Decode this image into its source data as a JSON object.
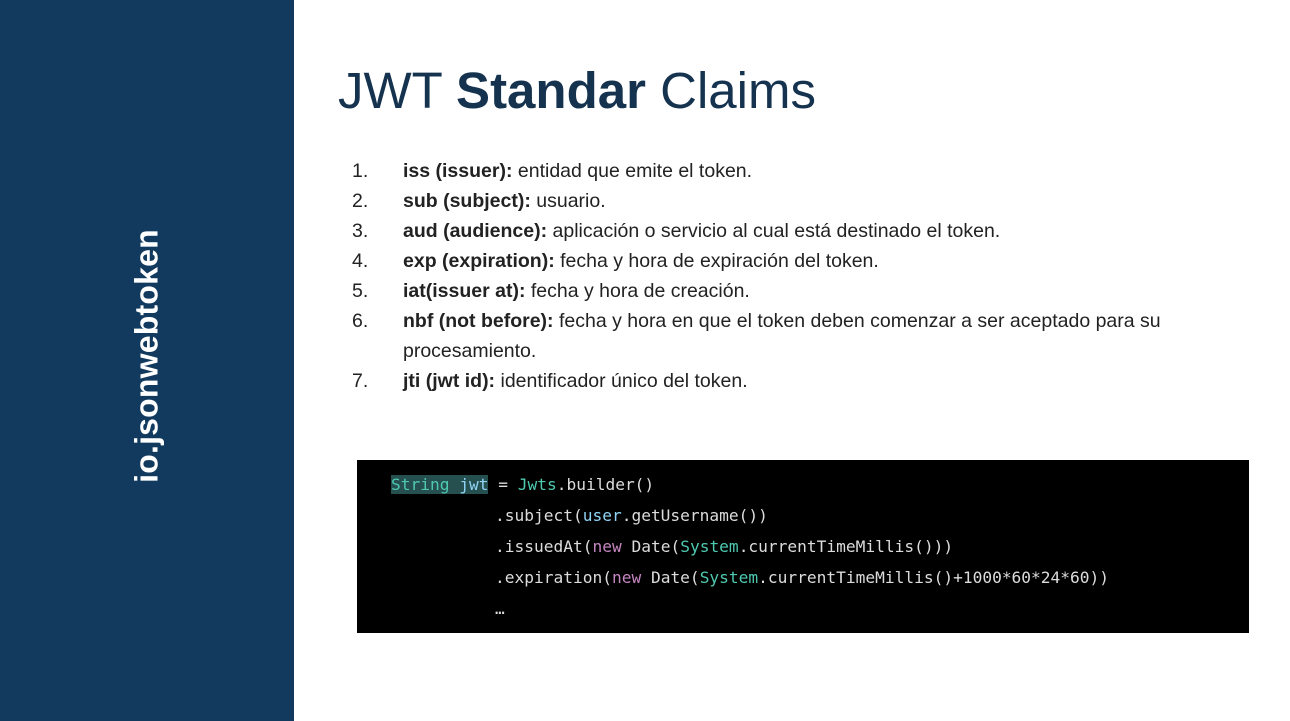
{
  "sidebar": {
    "vertical_text": "io.jsonwebtoken",
    "color": "#123a5f"
  },
  "title": {
    "part1": "JWT ",
    "part2_bold": "Standar",
    "part3": " Claims"
  },
  "claims": [
    {
      "num": "1.",
      "key": "iss (issuer):",
      "desc": " entidad que emite el token."
    },
    {
      "num": "2.",
      "key": "sub (subject):",
      "desc": " usuario."
    },
    {
      "num": "3.",
      "key": "aud (audience):",
      "desc": " aplicación o servicio al cual está destinado el token."
    },
    {
      "num": "4.",
      "key": "exp (expiration):",
      "desc": " fecha y hora de expiración del token."
    },
    {
      "num": "5.",
      "key": "iat(issuer at):",
      "desc": " fecha y hora de creación."
    },
    {
      "num": "6.",
      "key": "nbf (not before):",
      "desc": " fecha y hora en que el token deben comenzar a ser aceptado para su procesamiento."
    },
    {
      "num": "7.",
      "key": "jti (jwt id):",
      "desc": " identificador único del token."
    }
  ],
  "code": {
    "line1": {
      "t1": "String",
      "t2": " ",
      "t3": "jwt",
      "t4": " = ",
      "t5": "Jwts",
      "t6": ".builder()"
    },
    "line2": {
      "t1": ".subject(",
      "t2": "user",
      "t3": ".getUsername())"
    },
    "line3": {
      "t1": ".issuedAt(",
      "t2": "new",
      "t3": " Date(",
      "t4": "System",
      "t5": ".currentTimeMillis()))"
    },
    "line4": {
      "t1": ".expiration(",
      "t2": "new",
      "t3": " Date(",
      "t4": "System",
      "t5": ".currentTimeMillis()+1000*60*24*60))"
    },
    "line5": {
      "t1": "…"
    }
  }
}
